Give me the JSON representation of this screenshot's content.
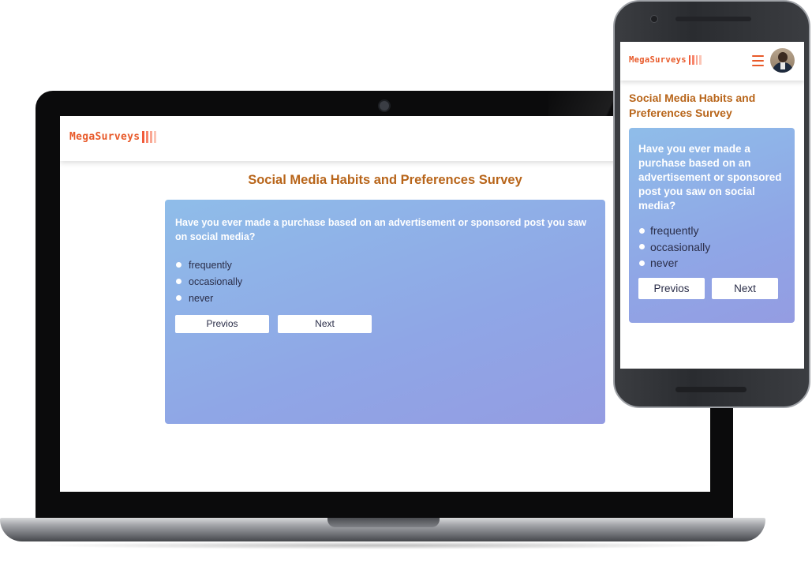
{
  "brand": {
    "logo_text": "MegaSurveys",
    "logo_bar_colors": [
      "#f15a3a",
      "#f7846a",
      "#f9a692",
      "#fbc5b6"
    ],
    "accent": "#e85a2a",
    "title_color": "#b8651a"
  },
  "survey": {
    "title": "Social Media Habits and Preferences Survey",
    "question": "Have you ever made a purchase based on an advertisement or sponsored post you saw on social media?",
    "options": [
      "frequently",
      "occasionally",
      "never"
    ],
    "prev_label": "Previos",
    "next_label": "Next"
  },
  "mobile": {
    "menu_icon": "hamburger-menu-icon",
    "avatar_icon": "user-avatar"
  }
}
